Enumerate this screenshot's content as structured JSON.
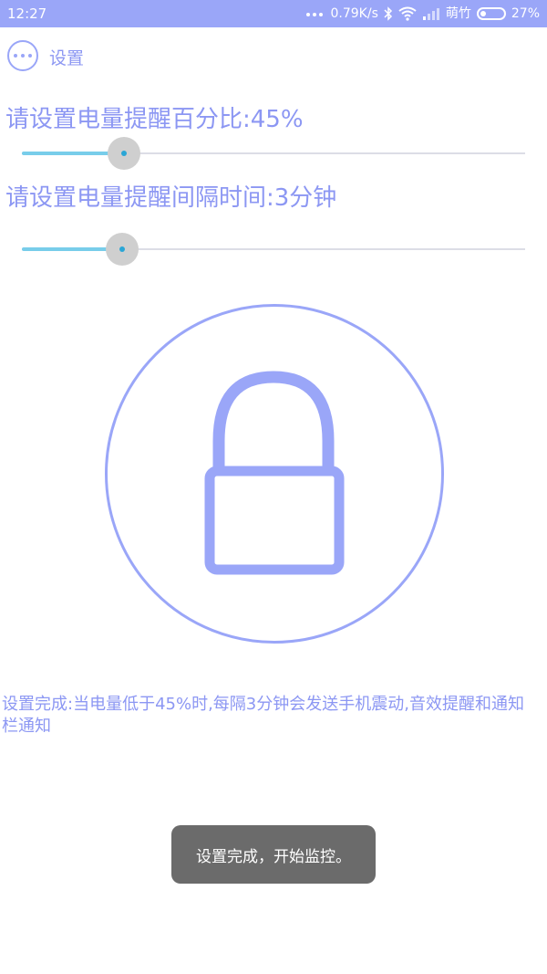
{
  "status_bar": {
    "time": "12:27",
    "network_speed": "0.79K/s",
    "carrier": "萌竹",
    "battery": "27%",
    "battery_level": 0.27
  },
  "toolbar": {
    "title": "设置"
  },
  "settings": {
    "percent_label": "请设置电量提醒百分比:45%",
    "percent_value": 45,
    "interval_label": "请设置电量提醒间隔时间:3分钟",
    "interval_value": 3
  },
  "info": {
    "message": "设置完成:当电量低于45%时,每隔3分钟会发送手机震动,音效提醒和通知栏通知"
  },
  "toast": {
    "message": "设置完成，开始监控。"
  },
  "colors": {
    "accent": "#9aa6f8",
    "text": "#8c97f3",
    "slider_progress": "#78cdea",
    "slider_thumb": "#cfcfcf",
    "toast_bg": "#6b6b6b"
  },
  "icons": {
    "menu": "more-dots-icon",
    "lock": "lock-icon"
  }
}
